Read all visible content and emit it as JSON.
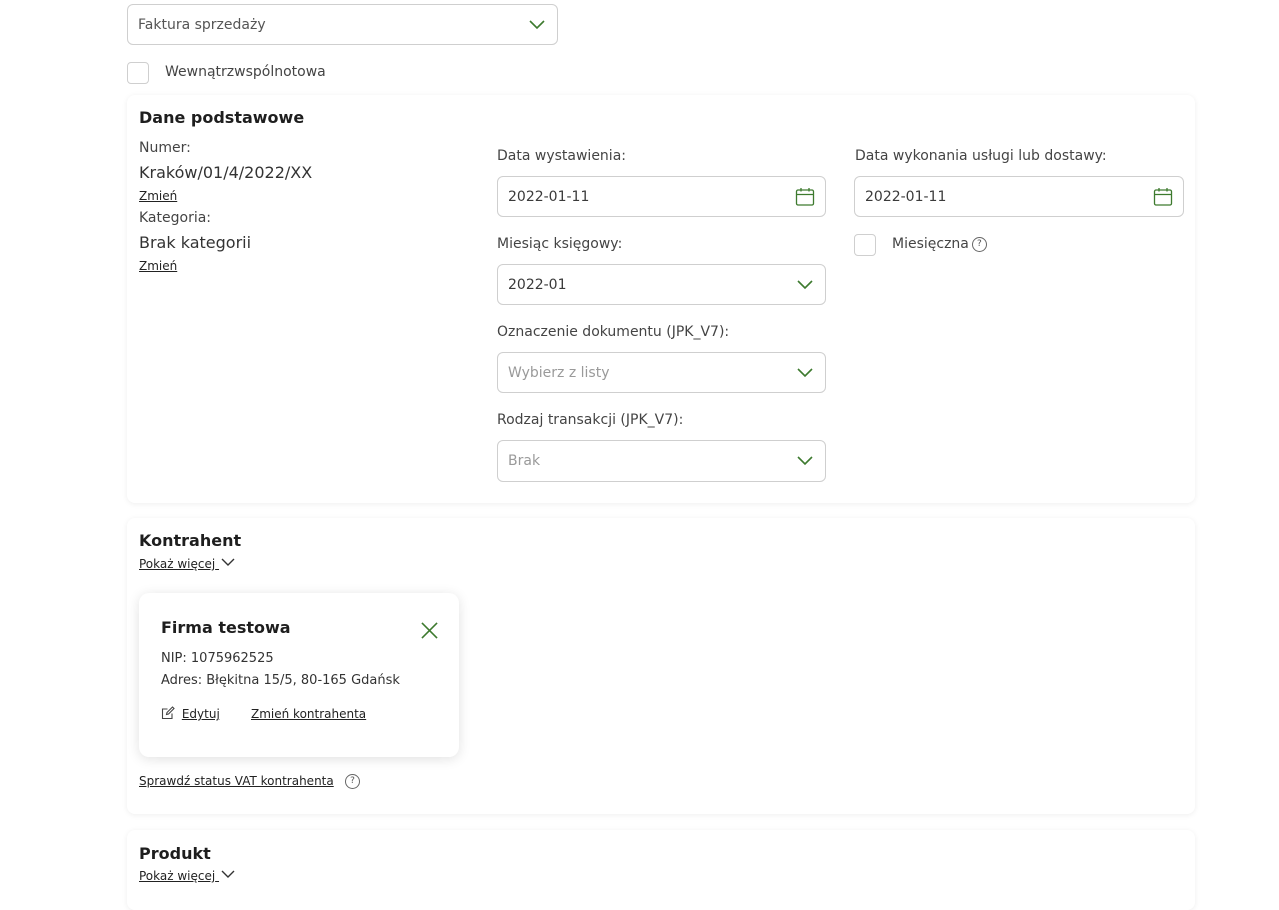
{
  "document_type": {
    "value": "Faktura sprzedaży"
  },
  "intra_community": {
    "label": "Wewnątrzwspólnotowa"
  },
  "basic": {
    "title": "Dane podstawowe",
    "number_label": "Numer:",
    "number_value": "Kraków/01/4/2022/XX",
    "change_label": "Zmień",
    "category_label": "Kategoria:",
    "category_value": "Brak kategorii",
    "issue_date_label": "Data wystawienia:",
    "issue_date_value": "2022-01-11",
    "service_date_label": "Data wykonania usługi lub dostawy:",
    "service_date_value": "2022-01-11",
    "monthly_label": "Miesięczna",
    "accounting_month_label": "Miesiąc księgowy:",
    "accounting_month_value": "2022-01",
    "doc_marking_label": "Oznaczenie dokumentu (JPK_V7):",
    "doc_marking_placeholder": "Wybierz z listy",
    "transaction_type_label": "Rodzaj transakcji (JPK_V7):",
    "transaction_type_value": "Brak"
  },
  "contractor": {
    "title": "Kontrahent",
    "show_more": "Pokaż więcej",
    "name": "Firma testowa",
    "nip": "NIP: 1075962525",
    "address": "Adres: Błękitna 15/5, 80-165 Gdańsk",
    "edit_label": "Edytuj",
    "change_label": "Zmień kontrahenta",
    "vat_check": "Sprawdź status VAT kontrahenta"
  },
  "product": {
    "title": "Produkt",
    "show_more": "Pokaż więcej"
  },
  "colors": {
    "accent": "#3d7a2e",
    "border": "#cfcfcf"
  },
  "icons": {
    "dropdown": "chevron-down-icon",
    "calendar": "calendar-icon",
    "help": "question-circle-icon",
    "close": "close-icon",
    "edit": "edit-icon"
  }
}
